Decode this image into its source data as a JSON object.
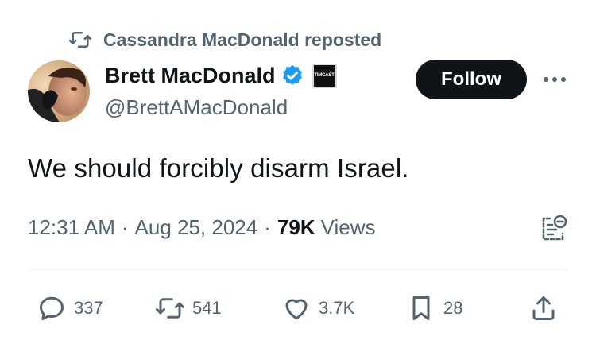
{
  "repost": {
    "icon": "repost-icon",
    "text": "Cassandra MacDonald reposted"
  },
  "author": {
    "name": "Brett MacDonald",
    "handle": "@BrettAMacDonald",
    "verified_icon": "verified-badge-icon",
    "affiliate_badge": "TIMCAST"
  },
  "follow_label": "Follow",
  "tweet": {
    "text": "We should forcibly disarm Israel."
  },
  "meta": {
    "time": "12:31 AM",
    "separator": "·",
    "date": "Aug 25, 2024",
    "views_count": "79K",
    "views_label": "Views"
  },
  "actions": {
    "replies": "337",
    "reposts": "541",
    "likes": "3.7K",
    "bookmarks": "28"
  },
  "colors": {
    "text": "#0f1419",
    "secondary": "#536471",
    "verified": "#1d9bf0",
    "divider": "#eff3f4",
    "follow_bg": "#0f1419"
  }
}
